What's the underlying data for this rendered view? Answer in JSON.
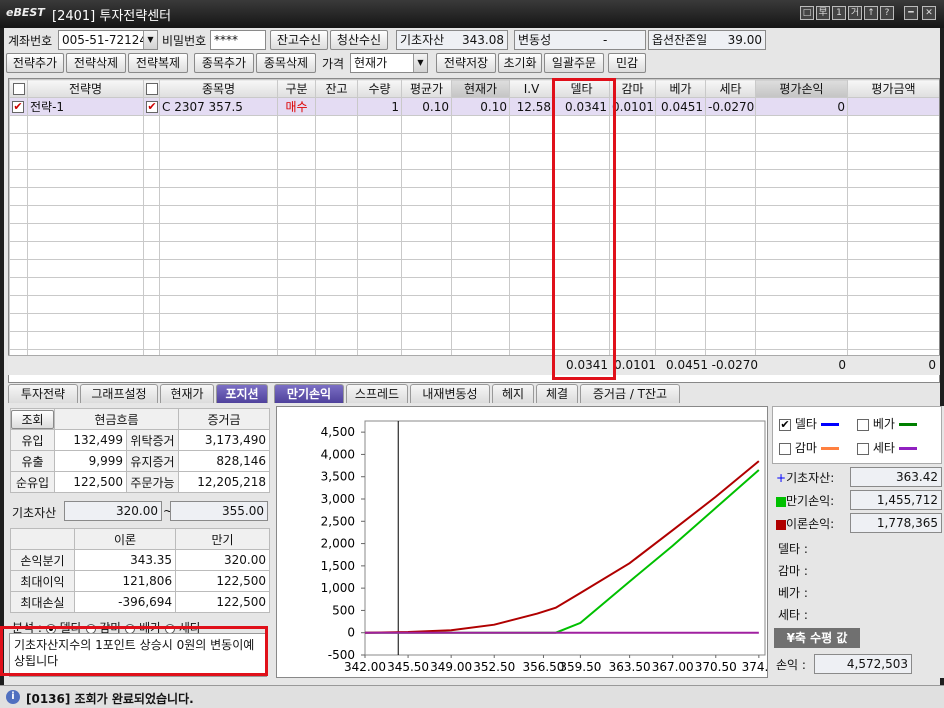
{
  "window": {
    "logo": "eBEST",
    "title": "[2401] 투자전략센터",
    "ctrl_icons": [
      "□",
      "早",
      "1",
      "거",
      "↑",
      "?",
      "━",
      "✕"
    ]
  },
  "top": {
    "account_label": "계좌번호",
    "account_value": "005-51-721245",
    "password_label": "비밀번호",
    "password_value": "****",
    "btn_balance": "잔고수신",
    "btn_settle": "청산수신",
    "base_asset_label": "기초자산",
    "base_asset_value": "343.08",
    "volatility_label": "변동성",
    "volatility_value": "-",
    "remaining_label": "옵션잔존일",
    "remaining_value": "39.00"
  },
  "toolbar": {
    "add_strategy": "전략추가",
    "del_strategy": "전략삭제",
    "copy_strategy": "전략복제",
    "add_item": "종목추가",
    "del_item": "종목삭제",
    "price_label": "가격",
    "price_value": "현재가",
    "save_strategy": "전략저장",
    "reset": "초기화",
    "bulk_order": "일괄주문",
    "sensitivity": "민감"
  },
  "grid": {
    "headers": [
      "",
      "전략명",
      "",
      "종목명",
      "구분",
      "잔고",
      "수량",
      "평균가",
      "현재가",
      "I.V",
      "델타",
      "감마",
      "베가",
      "세타",
      "평가손익",
      "평가금액"
    ],
    "row": {
      "strategy": "전략-1",
      "item": "C 2307 357.5",
      "side": "매수",
      "balance": "",
      "qty": "1",
      "avg": "0.10",
      "cur": "0.10",
      "iv": "12.58",
      "delta": "0.0341",
      "gamma": "0.0101",
      "vega": "0.0451",
      "theta": "-0.0270",
      "pnl": "0",
      "eval": ""
    },
    "sum": {
      "delta": "0.0341",
      "gamma": "0.0101",
      "vega": "0.0451",
      "theta": "-0.0270",
      "pnl": "0",
      "eval": "0"
    }
  },
  "tabs": [
    "투자전략",
    "그래프설정",
    "현재가",
    "포지션",
    "만기손익",
    "스프레드",
    "내재변동성",
    "헤지",
    "체결",
    "증거금 / T잔고"
  ],
  "left": {
    "query_btn": "조회",
    "cash_flow": "현금흐름",
    "margin": "증거금",
    "rows": [
      {
        "k": "유입",
        "v": "132,499",
        "k2": "위탁증거",
        "v2": "3,173,490"
      },
      {
        "k": "유출",
        "v": "9,999",
        "k2": "유지증거",
        "v2": "828,146"
      },
      {
        "k": "순유입",
        "v": "122,500",
        "k2": "주문가능",
        "v2": "12,205,218"
      }
    ],
    "base_label": "기초자산",
    "base_from": "320.00",
    "base_tilde": "~",
    "base_to": "355.00",
    "th_theory": "이론",
    "th_expiry": "만기",
    "rows2": [
      {
        "k": "손익분기",
        "a": "343.35",
        "b": "320.00"
      },
      {
        "k": "최대이익",
        "a": "121,806",
        "b": "122,500"
      },
      {
        "k": "최대손실",
        "a": "-396,694",
        "b": "122,500"
      }
    ],
    "analysis_label": "분석 :",
    "radios": [
      "델타",
      "감마",
      "베가",
      "세타"
    ],
    "message": "기초자산지수의 1포인트 상승시 0원의 변동이예상됩니다"
  },
  "chart_data": {
    "type": "line",
    "x": [
      342.0,
      345.5,
      349.0,
      352.5,
      356.0,
      357.5,
      359.5,
      363.5,
      367.0,
      370.5,
      374.0
    ],
    "xticks": [
      "342.00",
      "345.50",
      "349.00",
      "352.50",
      "356.50",
      "359.50",
      "363.50",
      "367.00",
      "370.50",
      "374.0"
    ],
    "yticks": [
      "4,500",
      "4,000",
      "3,500",
      "3,000",
      "2,500",
      "2,000",
      "1,500",
      "1,000",
      "500",
      "0",
      "-500"
    ],
    "ylim": [
      -500,
      4750
    ],
    "xlim": [
      342.0,
      374.5
    ],
    "series": [
      {
        "name": "만기손익",
        "color": "#00c000",
        "values": [
          0,
          0,
          0,
          0,
          0,
          0,
          220,
          1150,
          1950,
          2800,
          3650
        ]
      },
      {
        "name": "이론손익",
        "color": "#b00000",
        "values": [
          0,
          15,
          55,
          180,
          430,
          560,
          890,
          1560,
          2300,
          3050,
          3850
        ]
      },
      {
        "name": "세타",
        "color": "#a020a0",
        "values": [
          0,
          0,
          0,
          0,
          0,
          0,
          0,
          0,
          0,
          0,
          0
        ]
      }
    ],
    "cursor_x": 344.7
  },
  "right": {
    "legend": [
      {
        "label": "델타",
        "color": "#0000ff",
        "checked": true
      },
      {
        "label": "베가",
        "color": "#008000",
        "checked": false
      },
      {
        "label": "감마",
        "color": "#ff8040",
        "checked": false
      },
      {
        "label": "세타",
        "color": "#9020c0",
        "checked": false
      }
    ],
    "base_label": "기초자산:",
    "base_value": "363.42",
    "expiry_label": "만기손익:",
    "expiry_value": "1,455,712",
    "theory_label": "이론손익:",
    "theory_value": "1,778,365",
    "greeks": [
      "델타 :",
      "감마 :",
      "베가 :",
      "세타 :"
    ],
    "yaxis_btn": "¥축 수평 값",
    "pnl_label": "손익 :",
    "pnl_value": "4,572,503"
  },
  "status": {
    "icon": "i",
    "text": "[0136] 조회가 완료되었습니다."
  }
}
